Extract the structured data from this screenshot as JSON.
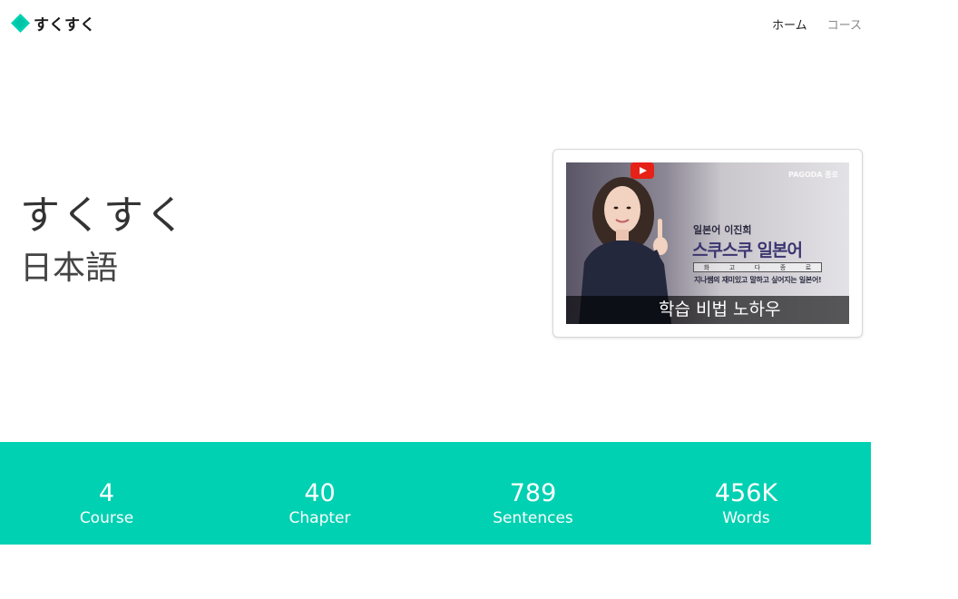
{
  "header": {
    "brand": "すくすく",
    "nav": [
      {
        "label": "ホーム"
      },
      {
        "label": "コース"
      }
    ]
  },
  "hero": {
    "title": "すくすく",
    "subtitle": "日本語"
  },
  "video": {
    "brand_mark": "PAGODA 종로",
    "line1": "일본어 이진희",
    "line2": "스쿠스쿠 일본어",
    "box_chars": [
      "화",
      "고",
      "다",
      "종",
      "로"
    ],
    "line3": "지나쌤의 재미있고 말하고 싶어지는 일본어!",
    "caption": "학습 비법 노하우"
  },
  "stats": [
    {
      "value": "4",
      "label": "Course"
    },
    {
      "value": "40",
      "label": "Chapter"
    },
    {
      "value": "789",
      "label": "Sentences"
    },
    {
      "value": "456K",
      "label": "Words"
    }
  ],
  "colors": {
    "accent": "#00d1b2",
    "text": "#333333",
    "youtube": "#e62117"
  }
}
